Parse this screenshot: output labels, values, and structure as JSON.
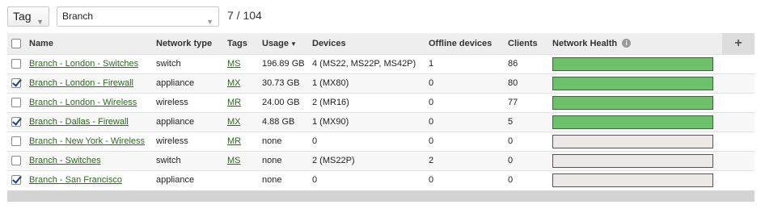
{
  "filter": {
    "tag_label": "Tag",
    "search_value": "Branch",
    "count": "7 / 104"
  },
  "columns": {
    "name": "Name",
    "network_type": "Network type",
    "tags": "Tags",
    "usage": "Usage",
    "devices": "Devices",
    "offline_devices": "Offline devices",
    "clients": "Clients",
    "network_health": "Network Health",
    "add": "+"
  },
  "colors": {
    "health_good": "#6cc16a",
    "health_none": "#ece8e8",
    "link": "#2c6b1e"
  },
  "rows": [
    {
      "checked": false,
      "name": "Branch - London - Switches",
      "type": "switch",
      "tag": "MS",
      "usage": "196.89 GB",
      "devices": "4  (MS22, MS22P, MS42P)",
      "offline": "1",
      "clients": "86",
      "health": "good"
    },
    {
      "checked": true,
      "name": "Branch - London - Firewall",
      "type": "appliance",
      "tag": "MX",
      "usage": "30.73 GB",
      "devices": "1  (MX80)",
      "offline": "0",
      "clients": "80",
      "health": "good"
    },
    {
      "checked": false,
      "name": "Branch - London - Wireless",
      "type": "wireless",
      "tag": "MR",
      "usage": "24.00 GB",
      "devices": "2  (MR16)",
      "offline": "0",
      "clients": "77",
      "health": "good"
    },
    {
      "checked": true,
      "name": "Branch - Dallas - Firewall",
      "type": "appliance",
      "tag": "MX",
      "usage": "4.88 GB",
      "devices": "1  (MX90)",
      "offline": "0",
      "clients": "5",
      "health": "good"
    },
    {
      "checked": false,
      "name": "Branch - New York - Wireless",
      "type": "wireless",
      "tag": "MR",
      "usage": "none",
      "devices": "0",
      "offline": "0",
      "clients": "0",
      "health": "none"
    },
    {
      "checked": false,
      "name": "Branch - Switches",
      "type": "switch",
      "tag": "MS",
      "usage": "none",
      "devices": "2  (MS22P)",
      "offline": "2",
      "clients": "0",
      "health": "none"
    },
    {
      "checked": true,
      "name": "Branch - San Francisco",
      "type": "appliance",
      "tag": "",
      "usage": "none",
      "devices": "0",
      "offline": "0",
      "clients": "0",
      "health": "none"
    }
  ]
}
